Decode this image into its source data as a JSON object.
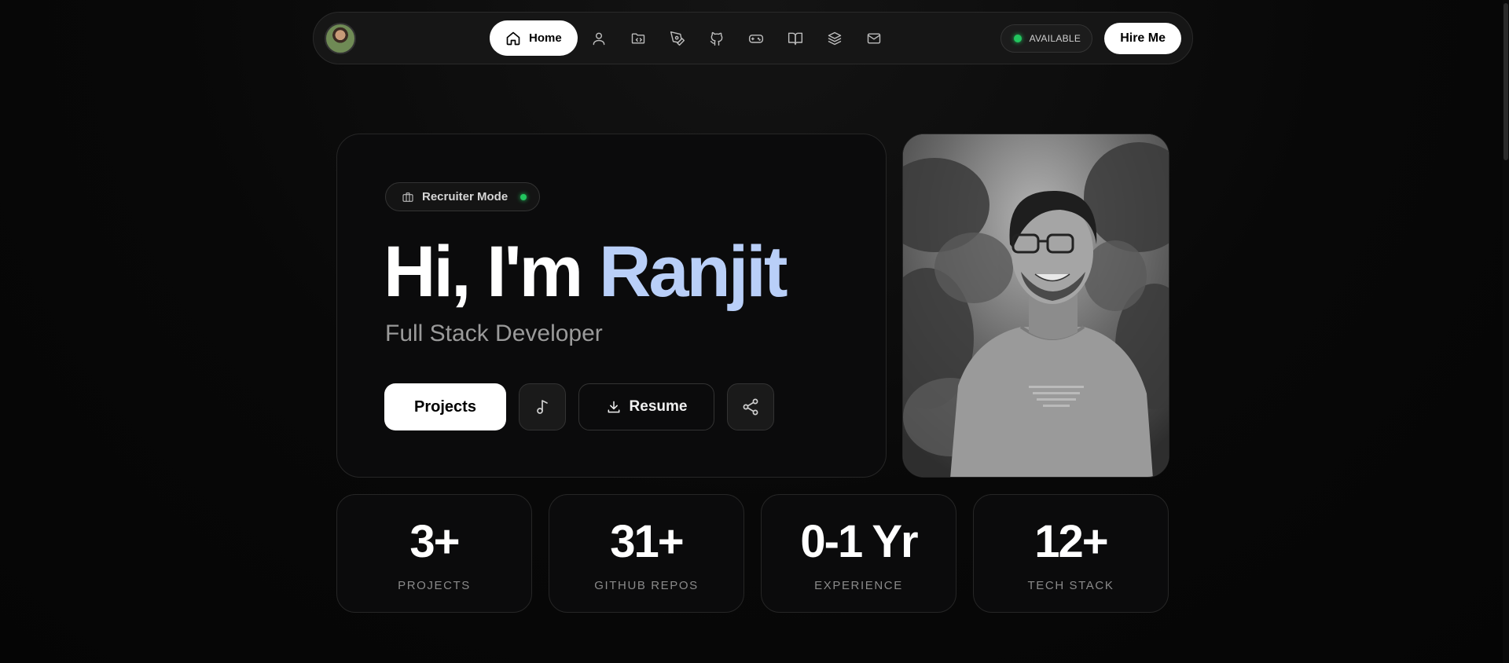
{
  "nav": {
    "home_label": "Home",
    "icons": [
      "user-icon",
      "projects-icon",
      "pen-tool-icon",
      "github-icon",
      "gamepad-icon",
      "book-icon",
      "layers-icon",
      "mail-icon"
    ],
    "availability": "AVAILABLE",
    "hire_label": "Hire Me"
  },
  "hero": {
    "badge": "Recruiter Mode",
    "greeting": "Hi, I'm",
    "name": "Ranjit",
    "subtitle": "Full Stack Developer",
    "projects_label": "Projects",
    "resume_label": "Resume"
  },
  "stats": [
    {
      "value": "3+",
      "label": "PROJECTS"
    },
    {
      "value": "31+",
      "label": "GITHUB REPOS"
    },
    {
      "value": "0-1 Yr",
      "label": "EXPERIENCE"
    },
    {
      "value": "12+",
      "label": "TECH STACK"
    }
  ],
  "colors": {
    "accent_name": "#b9cff8",
    "status_green": "#22c55e",
    "background": "#080808"
  }
}
